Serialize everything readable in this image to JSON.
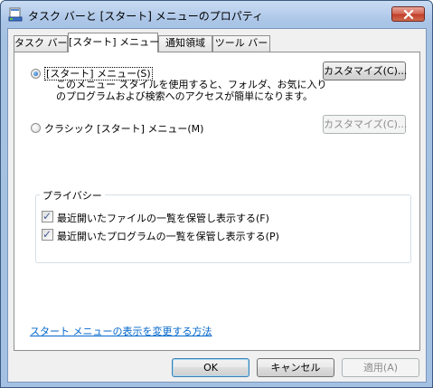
{
  "window": {
    "title": "タスク バーと [スタート] メニューのプロパティ"
  },
  "tabs": [
    {
      "label": "タスク バー"
    },
    {
      "label": "[スタート] メニュー"
    },
    {
      "label": "通知領域"
    },
    {
      "label": "ツール バー"
    }
  ],
  "start_menu": {
    "radio_start": {
      "label": "[スタート] メニュー(S)",
      "selected": true,
      "description_line1": "このメニュー スタイルを使用すると、フォルダ、お気に入り",
      "description_line2": "のプログラムおよび検索へのアクセスが簡単になります。",
      "customize_label": "カスタマイズ(C)..."
    },
    "radio_classic": {
      "label": "クラシック [スタート] メニュー(M)",
      "selected": false,
      "customize_label": "カスタマイズ(C)..."
    }
  },
  "privacy": {
    "title": "プライバシー",
    "items": [
      {
        "label": "最近開いたファイルの一覧を保管し表示する(F)",
        "checked": true
      },
      {
        "label": "最近開いたプログラムの一覧を保管し表示する(P)",
        "checked": true
      }
    ]
  },
  "help_link": "スタート メニューの表示を変更する方法",
  "footer": {
    "ok": "OK",
    "cancel": "キャンセル",
    "apply": "適用(A)"
  },
  "icons": {
    "app": "taskbar-icon",
    "close": "close-icon",
    "check": "✓"
  }
}
